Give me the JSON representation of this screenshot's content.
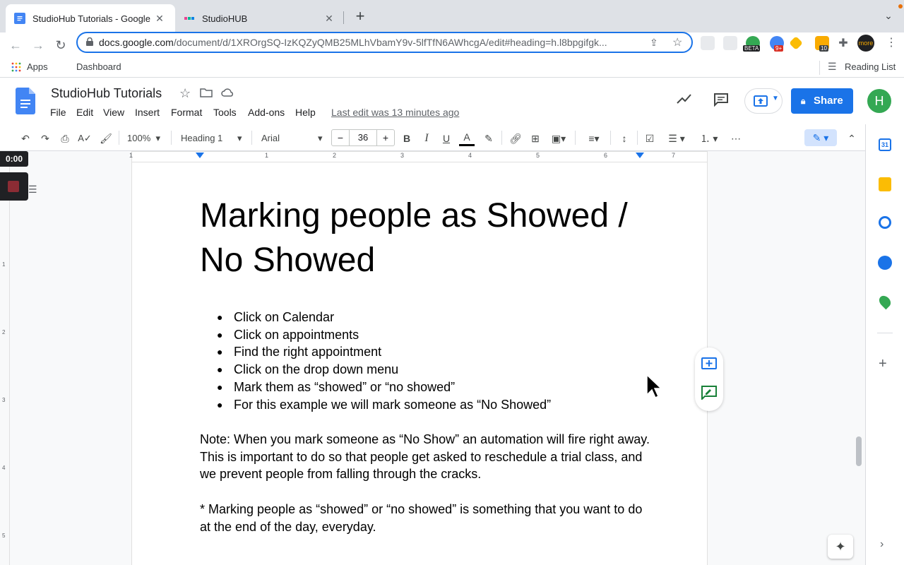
{
  "browser": {
    "tabs": [
      {
        "title": "StudioHub Tutorials - Google D"
      },
      {
        "title": "StudioHUB"
      }
    ],
    "url_host": "docs.google.com",
    "url_path": "/document/d/1XROrgSQ-IzKQZyQMB25MLhVbamY9v-5lfTfN6AWhcgA/edit#heading=h.l8bpgifgk...",
    "ext_badge_beta": "BETA",
    "ext_badge_count": "9+",
    "ext_badge_10": "10",
    "profile_label": "more",
    "bookmarks": {
      "apps": "Apps",
      "dashboard": "Dashboard",
      "reading_list": "Reading List"
    }
  },
  "docs": {
    "title": "StudioHub Tutorials",
    "menu": [
      "File",
      "Edit",
      "View",
      "Insert",
      "Format",
      "Tools",
      "Add-ons",
      "Help"
    ],
    "last_edit": "Last edit was 13 minutes ago",
    "share_label": "Share",
    "avatar_letter": "H",
    "toolbar": {
      "zoom": "100%",
      "style": "Heading 1",
      "font": "Arial",
      "font_size": "36",
      "minus": "−",
      "plus": "+"
    },
    "ruler_marks": [
      "1",
      "1",
      "2",
      "3",
      "4",
      "5",
      "6",
      "7"
    ],
    "vruler_marks": [
      "1",
      "2",
      "3",
      "4",
      "5"
    ],
    "recorder_time": "0:00"
  },
  "document": {
    "heading": "Marking people as Showed / No Showed",
    "bullets": [
      "Click on Calendar",
      "Click on appointments",
      "Find the right appointment",
      "Click on the drop down menu",
      "Mark them as “showed” or “no showed”",
      "For this example we will mark someone as “No Showed”"
    ],
    "note": "Note: When you mark someone as “No Show” an automation will fire right away. This is important to do so that people get asked to reschedule a trial class, and we prevent people from falling through the cracks.",
    "footnote": "* Marking people as “showed” or “no showed” is something that you want to do at the end of the day, everyday."
  },
  "colors": {
    "accent": "#1a73e8",
    "avatar": "#34a853"
  }
}
